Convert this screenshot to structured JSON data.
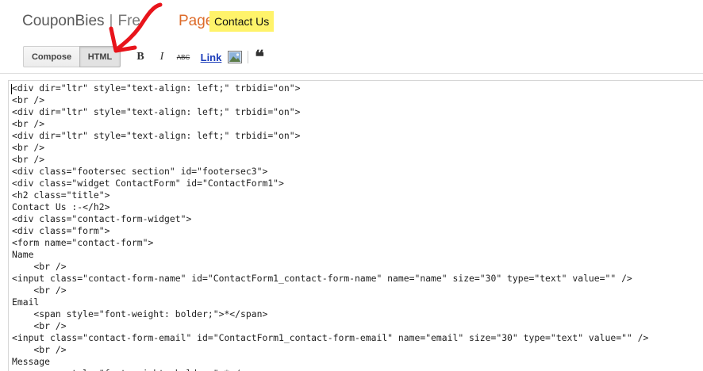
{
  "header": {
    "blog_name": "CouponBies",
    "separator": "|",
    "blog_name_tail": "Fre",
    "page_type": "Page",
    "post_title": "Contact Us"
  },
  "toolbar": {
    "compose_label": "Compose",
    "html_label": "HTML",
    "bold_label": "B",
    "italic_label": "I",
    "strike_label": "ABC",
    "link_label": "Link",
    "image_icon": "image-icon",
    "quote_label": "❝"
  },
  "editor": {
    "lines": [
      "<div dir=\"ltr\" style=\"text-align: left;\" trbidi=\"on\">",
      "<br />",
      "<div dir=\"ltr\" style=\"text-align: left;\" trbidi=\"on\">",
      "<br />",
      "<div dir=\"ltr\" style=\"text-align: left;\" trbidi=\"on\">",
      "<br />",
      "<br />",
      "<div class=\"footersec section\" id=\"footersec3\">",
      "<div class=\"widget ContactForm\" id=\"ContactForm1\">",
      "<h2 class=\"title\">",
      "Contact Us :-</h2>",
      "<div class=\"contact-form-widget\">",
      "<div class=\"form\">",
      "<form name=\"contact-form\">",
      "Name",
      "    <br />",
      "<input class=\"contact-form-name\" id=\"ContactForm1_contact-form-name\" name=\"name\" size=\"30\" type=\"text\" value=\"\" />",
      "    <br />",
      "Email",
      "    <span style=\"font-weight: bolder;\">*</span>",
      "    <br />",
      "<input class=\"contact-form-email\" id=\"ContactForm1_contact-form-email\" name=\"email\" size=\"30\" type=\"text\" value=\"\" />",
      "    <br />",
      "Message",
      "    <span style=\"font-weight: bolder;\">*</span>"
    ]
  },
  "colors": {
    "page_type": "#dd6b2a",
    "highlight": "#fff36a",
    "annotation_arrow": "#e8141b",
    "link": "#1c3dba"
  }
}
